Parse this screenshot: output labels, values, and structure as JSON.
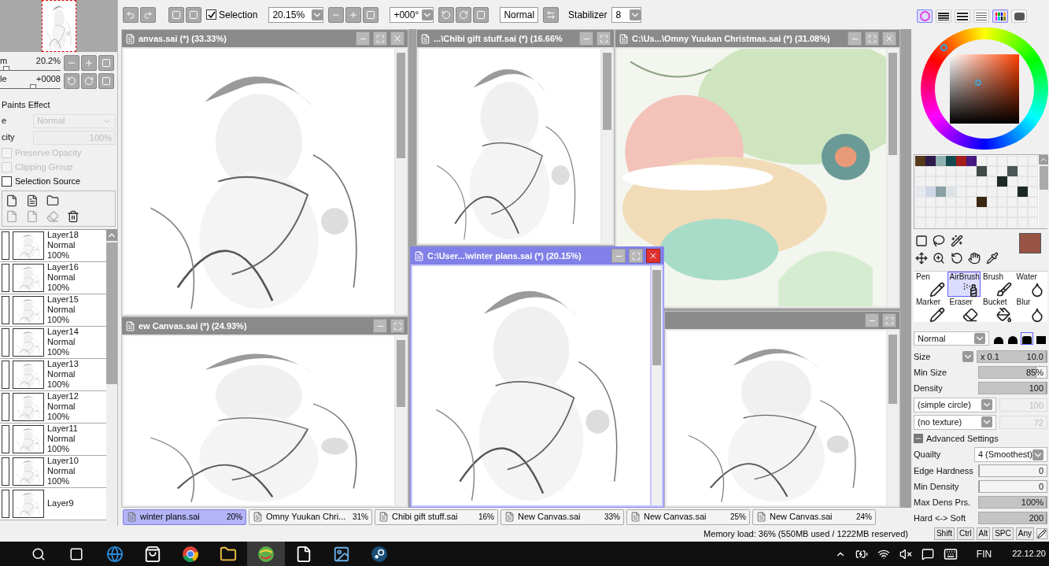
{
  "navigator": {
    "zoom": {
      "label": "m",
      "value": "20.2%",
      "level": 0.1
    },
    "angle": {
      "label": "le",
      "value": "+0008",
      "level": 0.55
    }
  },
  "layer_properties": {
    "title": "Paints Effect",
    "blend": {
      "label": "e",
      "value": "Normal",
      "disabled": true
    },
    "opacity": {
      "label": "city",
      "value": "100%",
      "disabled": true
    },
    "options": [
      {
        "label": "Preserve Opacity",
        "checked": false,
        "disabled": true
      },
      {
        "label": "Clipping Group",
        "checked": false,
        "disabled": true
      },
      {
        "label": "Selection Source",
        "checked": false,
        "disabled": false
      }
    ]
  },
  "layers": [
    {
      "name": "Layer18",
      "blend": "Normal",
      "opacity": "100%"
    },
    {
      "name": "Layer16",
      "blend": "Normal",
      "opacity": "100%"
    },
    {
      "name": "Layer15",
      "blend": "Normal",
      "opacity": "100%"
    },
    {
      "name": "Layer14",
      "blend": "Normal",
      "opacity": "100%"
    },
    {
      "name": "Layer13",
      "blend": "Normal",
      "opacity": "100%"
    },
    {
      "name": "Layer12",
      "blend": "Normal",
      "opacity": "100%"
    },
    {
      "name": "Layer11",
      "blend": "Normal",
      "opacity": "100%"
    },
    {
      "name": "Layer10",
      "blend": "Normal",
      "opacity": "100%"
    },
    {
      "name": "Layer9"
    }
  ],
  "toolbar": {
    "selection": {
      "label": "Selection",
      "checked": true
    },
    "zoom": "20.15%",
    "angle": "+000°",
    "mode": "Normal",
    "stabilizer": {
      "label": "Stabilizer",
      "value": "8"
    }
  },
  "windows": [
    {
      "title": "anvas.sai (*) (33.33%)",
      "active": false,
      "close": true
    },
    {
      "title": "...\\Chibi gift stuff.sai (*) (16.66%",
      "active": false,
      "close": false
    },
    {
      "title": "C:\\Us...\\Omny Yuukan Christmas.sai (*) (31.08%)",
      "active": false,
      "close": true
    },
    {
      "title": "ew Canvas.sai (*) (24.93%)",
      "active": false,
      "close": false
    },
    {
      "active": false,
      "close": false
    },
    {
      "title": "C:\\User...\\winter plans.sai (*) (20.15%)",
      "active": true,
      "close": true
    }
  ],
  "tabs": [
    {
      "name": "winter plans.sai",
      "percent": "20%",
      "selected": true
    },
    {
      "name": "Omny Yuukan Chri...",
      "percent": "31%",
      "selected": false
    },
    {
      "name": "Chibi gift stuff.sai",
      "percent": "16%",
      "selected": false
    },
    {
      "name": "New Canvas.sai",
      "percent": "33%",
      "selected": false
    },
    {
      "name": "New Canvas.sai",
      "percent": "25%",
      "selected": false
    },
    {
      "name": "New Canvas.sai",
      "percent": "24%",
      "selected": false
    }
  ],
  "color_modes": [
    {
      "kind": "wheel",
      "selected": true
    },
    {
      "kind": "rgb",
      "selected": false
    },
    {
      "kind": "hsv",
      "selected": false
    },
    {
      "kind": "bars",
      "selected": false
    },
    {
      "kind": "swatches",
      "selected": true
    },
    {
      "kind": "scratch",
      "selected": false
    }
  ],
  "swatches": [
    [
      {
        "kind": "color",
        "color": "#553a1b"
      },
      {
        "kind": "color",
        "color": "#2e1a4a"
      },
      {
        "kind": "color",
        "color": "#8fb0b0"
      },
      {
        "kind": "color",
        "color": "#134b50"
      },
      {
        "kind": "color",
        "color": "#a31e1a"
      },
      {
        "kind": "color",
        "color": "#4a1a80"
      },
      {
        "kind": "empty"
      },
      {
        "kind": "empty"
      },
      {
        "kind": "empty"
      },
      {
        "kind": "empty"
      },
      {
        "kind": "empty"
      },
      {
        "kind": "empty"
      }
    ],
    [
      {
        "kind": "empty"
      },
      {
        "kind": "empty"
      },
      {
        "kind": "empty"
      },
      {
        "kind": "empty"
      },
      {
        "kind": "empty"
      },
      {
        "kind": "empty"
      },
      {
        "kind": "color",
        "color": "#404a48"
      },
      {
        "kind": "empty"
      },
      {
        "kind": "empty"
      },
      {
        "kind": "color",
        "color": "#4a5656"
      },
      {
        "kind": "empty"
      },
      {
        "kind": "empty"
      }
    ],
    [
      {
        "kind": "empty"
      },
      {
        "kind": "empty"
      },
      {
        "kind": "empty"
      },
      {
        "kind": "empty"
      },
      {
        "kind": "empty"
      },
      {
        "kind": "empty"
      },
      {
        "kind": "empty"
      },
      {
        "kind": "empty"
      },
      {
        "kind": "color",
        "color": "#1e2c28"
      },
      {
        "kind": "empty"
      },
      {
        "kind": "empty"
      },
      {
        "kind": "empty"
      }
    ],
    [
      {
        "kind": "color",
        "color": "#e6e9ee"
      },
      {
        "kind": "color",
        "color": "#d0d8e6"
      },
      {
        "kind": "color",
        "color": "#88a0a6"
      },
      {
        "kind": "color",
        "color": "#dde2e6"
      },
      {
        "kind": "empty"
      },
      {
        "kind": "empty"
      },
      {
        "kind": "empty"
      },
      {
        "kind": "empty"
      },
      {
        "kind": "empty"
      },
      {
        "kind": "empty"
      },
      {
        "kind": "color",
        "color": "#1b2824"
      },
      {
        "kind": "empty"
      }
    ],
    [
      {
        "kind": "empty"
      },
      {
        "kind": "empty"
      },
      {
        "kind": "empty"
      },
      {
        "kind": "empty"
      },
      {
        "kind": "empty"
      },
      {
        "kind": "empty"
      },
      {
        "kind": "color",
        "color": "#3c2614"
      },
      {
        "kind": "empty"
      },
      {
        "kind": "empty"
      },
      {
        "kind": "empty"
      },
      {
        "kind": "empty"
      },
      {
        "kind": "empty"
      }
    ],
    [
      {
        "kind": "empty"
      },
      {
        "kind": "empty"
      },
      {
        "kind": "empty"
      },
      {
        "kind": "empty"
      },
      {
        "kind": "empty"
      },
      {
        "kind": "empty"
      },
      {
        "kind": "empty"
      },
      {
        "kind": "empty"
      },
      {
        "kind": "empty"
      },
      {
        "kind": "empty"
      },
      {
        "kind": "empty"
      },
      {
        "kind": "empty"
      }
    ],
    [
      {
        "kind": "empty"
      },
      {
        "kind": "empty"
      },
      {
        "kind": "empty"
      },
      {
        "kind": "empty"
      },
      {
        "kind": "empty"
      },
      {
        "kind": "empty"
      },
      {
        "kind": "empty"
      },
      {
        "kind": "empty"
      },
      {
        "kind": "empty"
      },
      {
        "kind": "empty"
      },
      {
        "kind": "empty"
      },
      {
        "kind": "empty"
      }
    ]
  ],
  "current_color": {
    "color": "#975444"
  },
  "brushes": [
    {
      "name": "Pen",
      "kind": "pen",
      "selected": false
    },
    {
      "name": "AirBrush",
      "kind": "airbrush",
      "selected": true
    },
    {
      "name": "Brush",
      "kind": "brush",
      "selected": false
    },
    {
      "name": "Water",
      "kind": "water",
      "selected": false
    },
    {
      "name": "Marker",
      "kind": "pen",
      "selected": false
    },
    {
      "name": "Eraser",
      "kind": "eraser",
      "selected": false
    },
    {
      "name": "Bucket",
      "kind": "bucket",
      "selected": false
    },
    {
      "name": "Blur",
      "kind": "water",
      "selected": false
    }
  ],
  "brush": {
    "blend": "Normal",
    "shapes": [
      {
        "selected": false
      },
      {
        "selected": false
      },
      {
        "selected": true
      },
      {
        "selected": false
      }
    ],
    "settings": [
      {
        "kind": "size",
        "label": "Size",
        "prefix": "x 0.1",
        "value": "10.0",
        "level": 1
      },
      {
        "kind": "slider",
        "label": "Min Size",
        "value": "85%",
        "level": 0.85
      },
      {
        "kind": "slider",
        "label": "Density",
        "value": "100",
        "level": 1
      },
      {
        "kind": "select",
        "label": "(simple circle)",
        "value": "100"
      },
      {
        "kind": "select",
        "label": "(no texture)",
        "value": "72"
      },
      {
        "kind": "section",
        "label": "Advanced Settings",
        "expanded": true
      },
      {
        "kind": "choice",
        "label": "Quailty",
        "value": "4 (Smoothest)"
      },
      {
        "kind": "slider",
        "label": "Edge Hardness",
        "value": "0",
        "level": 0
      },
      {
        "kind": "slider",
        "label": "Min Density",
        "value": "0",
        "level": 0
      },
      {
        "kind": "slider",
        "label": "Max Dens Prs.",
        "value": "100%",
        "level": 1
      },
      {
        "kind": "slider",
        "label": "Hard <-> Soft",
        "value": "200",
        "level": 1
      }
    ]
  },
  "status_bar": {
    "memory": "Memory load: 36% (550MB used / 1222MB reserved)",
    "keys": [
      "Shift",
      "Ctrl",
      "Alt",
      "SPC",
      "Any"
    ]
  },
  "taskbar": {
    "apps": [
      {
        "kind": "edge",
        "active": false
      },
      {
        "kind": "store",
        "active": false
      },
      {
        "kind": "chrome",
        "active": false
      },
      {
        "kind": "folder",
        "active": false
      },
      {
        "kind": "paint",
        "active": true
      },
      {
        "kind": "file",
        "active": false
      },
      {
        "kind": "photos",
        "active": false
      },
      {
        "kind": "steam",
        "active": false
      }
    ],
    "language": "FIN",
    "date": "22.12.20"
  }
}
